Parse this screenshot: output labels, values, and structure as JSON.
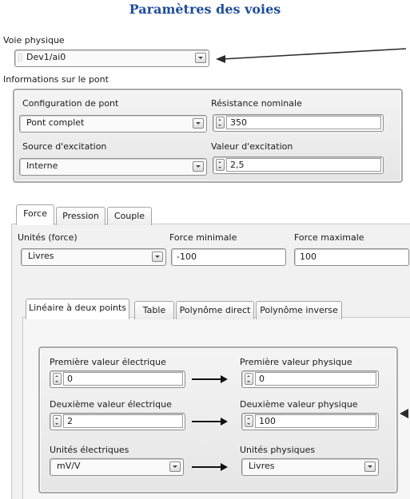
{
  "title": "Paramètres des voies",
  "physical_channel": {
    "label": "Voie physique",
    "value": "Dev1/ai0"
  },
  "bridge": {
    "section_label": "Informations sur le pont",
    "config": {
      "label": "Configuration de pont",
      "value": "Pont complet"
    },
    "nominal_resistance": {
      "label": "Résistance nominale",
      "value": "350"
    },
    "excitation_source": {
      "label": "Source d'excitation",
      "value": "Interne"
    },
    "excitation_value": {
      "label": "Valeur d'excitation",
      "value": "2,5"
    }
  },
  "measure_tabs": [
    "Force",
    "Pression",
    "Couple"
  ],
  "force": {
    "units_label": "Unités (force)",
    "units_value": "Livres",
    "min_label": "Force minimale",
    "min_value": "-100",
    "max_label": "Force maximale",
    "max_value": "100"
  },
  "scaling_tabs": [
    "Linéaire à deux points",
    "Table",
    "Polynôme direct",
    "Polynôme inverse"
  ],
  "two_point": {
    "first_elec_label": "Première valeur électrique",
    "first_elec_value": "0",
    "first_phys_label": "Première valeur physique",
    "first_phys_value": "0",
    "second_elec_label": "Deuxième valeur électrique",
    "second_elec_value": "2",
    "second_phys_label": "Deuxième valeur physique",
    "second_phys_value": "100",
    "elec_units_label": "Unités électriques",
    "elec_units_value": "mV/V",
    "phys_units_label": "Unités physiques",
    "phys_units_value": "Livres"
  },
  "icons": {
    "channel_icon": "channel-ghost-icon",
    "dropdown": "chevron-down-icon",
    "spinner": "up-down-spinner-icon",
    "annotation_arrow": "left-arrow-icon"
  },
  "colors": {
    "title": "#1f4e9a",
    "group_border": "#a9a9a9",
    "arrow": "#111111"
  }
}
